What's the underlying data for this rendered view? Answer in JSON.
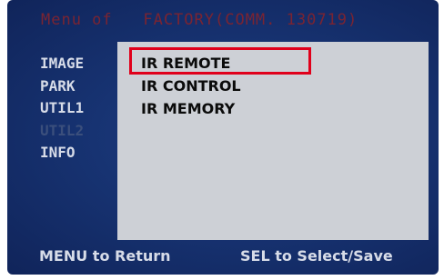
{
  "header": {
    "title": "Menu of   FACTORY(COMM. 130719)"
  },
  "left_menu": {
    "items": [
      {
        "label": "IMAGE",
        "enabled": true
      },
      {
        "label": "PARK",
        "enabled": true
      },
      {
        "label": "UTIL1",
        "enabled": true
      },
      {
        "label": "UTIL2",
        "enabled": false
      },
      {
        "label": "INFO",
        "enabled": true
      }
    ]
  },
  "submenu": {
    "items": [
      {
        "label": "IR REMOTE",
        "selected": true
      },
      {
        "label": "IR CONTROL",
        "selected": false
      },
      {
        "label": "IR MEMORY",
        "selected": false
      }
    ]
  },
  "footer": {
    "left_hint": "MENU to Return",
    "right_hint": "SEL to Select/Save"
  },
  "colors": {
    "background": "#173372",
    "panel": "#cdd0d6",
    "highlight_border": "#e0001b",
    "title_text": "#7a2432",
    "menu_text": "#d7dce8",
    "disabled_text": "#3b4f7c"
  }
}
